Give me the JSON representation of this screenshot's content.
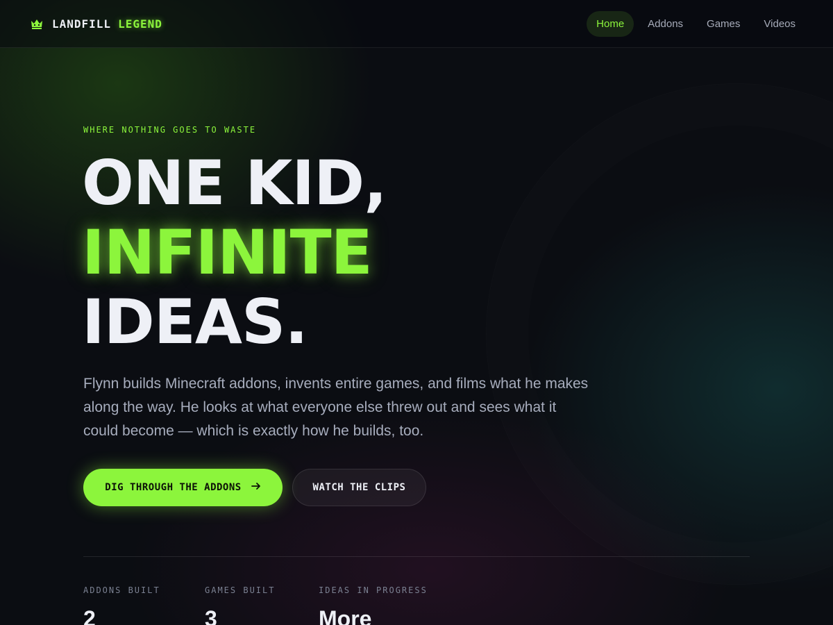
{
  "nav": {
    "brand_icon": "crown-icon",
    "brand_part1": "LANDFILL",
    "brand_part2": "LEGEND",
    "links": [
      {
        "label": "Home",
        "active": true
      },
      {
        "label": "Addons",
        "active": false
      },
      {
        "label": "Games",
        "active": false
      },
      {
        "label": "Videos",
        "active": false
      }
    ]
  },
  "hero": {
    "eyebrow": "WHERE NOTHING GOES TO WASTE",
    "headline_line1": "ONE KID,",
    "headline_line2": "INFINITE",
    "headline_line3": "IDEAS.",
    "lead": "Flynn builds Minecraft addons, invents entire games, and films what he makes along the way. He looks at what everyone else threw out and sees what it could become — which is exactly how he builds, too.",
    "primary_button": "DIG THROUGH THE ADDONS",
    "primary_button_icon": "arrow-right-icon",
    "secondary_button": "WATCH THE CLIPS"
  },
  "stats": [
    {
      "label": "ADDONS BUILT",
      "value": "2"
    },
    {
      "label": "GAMES BUILT",
      "value": "3"
    },
    {
      "label": "IDEAS IN PROGRESS",
      "value": "More"
    }
  ],
  "colors": {
    "accent": "#8cf53c",
    "background": "#0b0d12",
    "text": "#eef0f6",
    "muted": "#a7adbd"
  }
}
